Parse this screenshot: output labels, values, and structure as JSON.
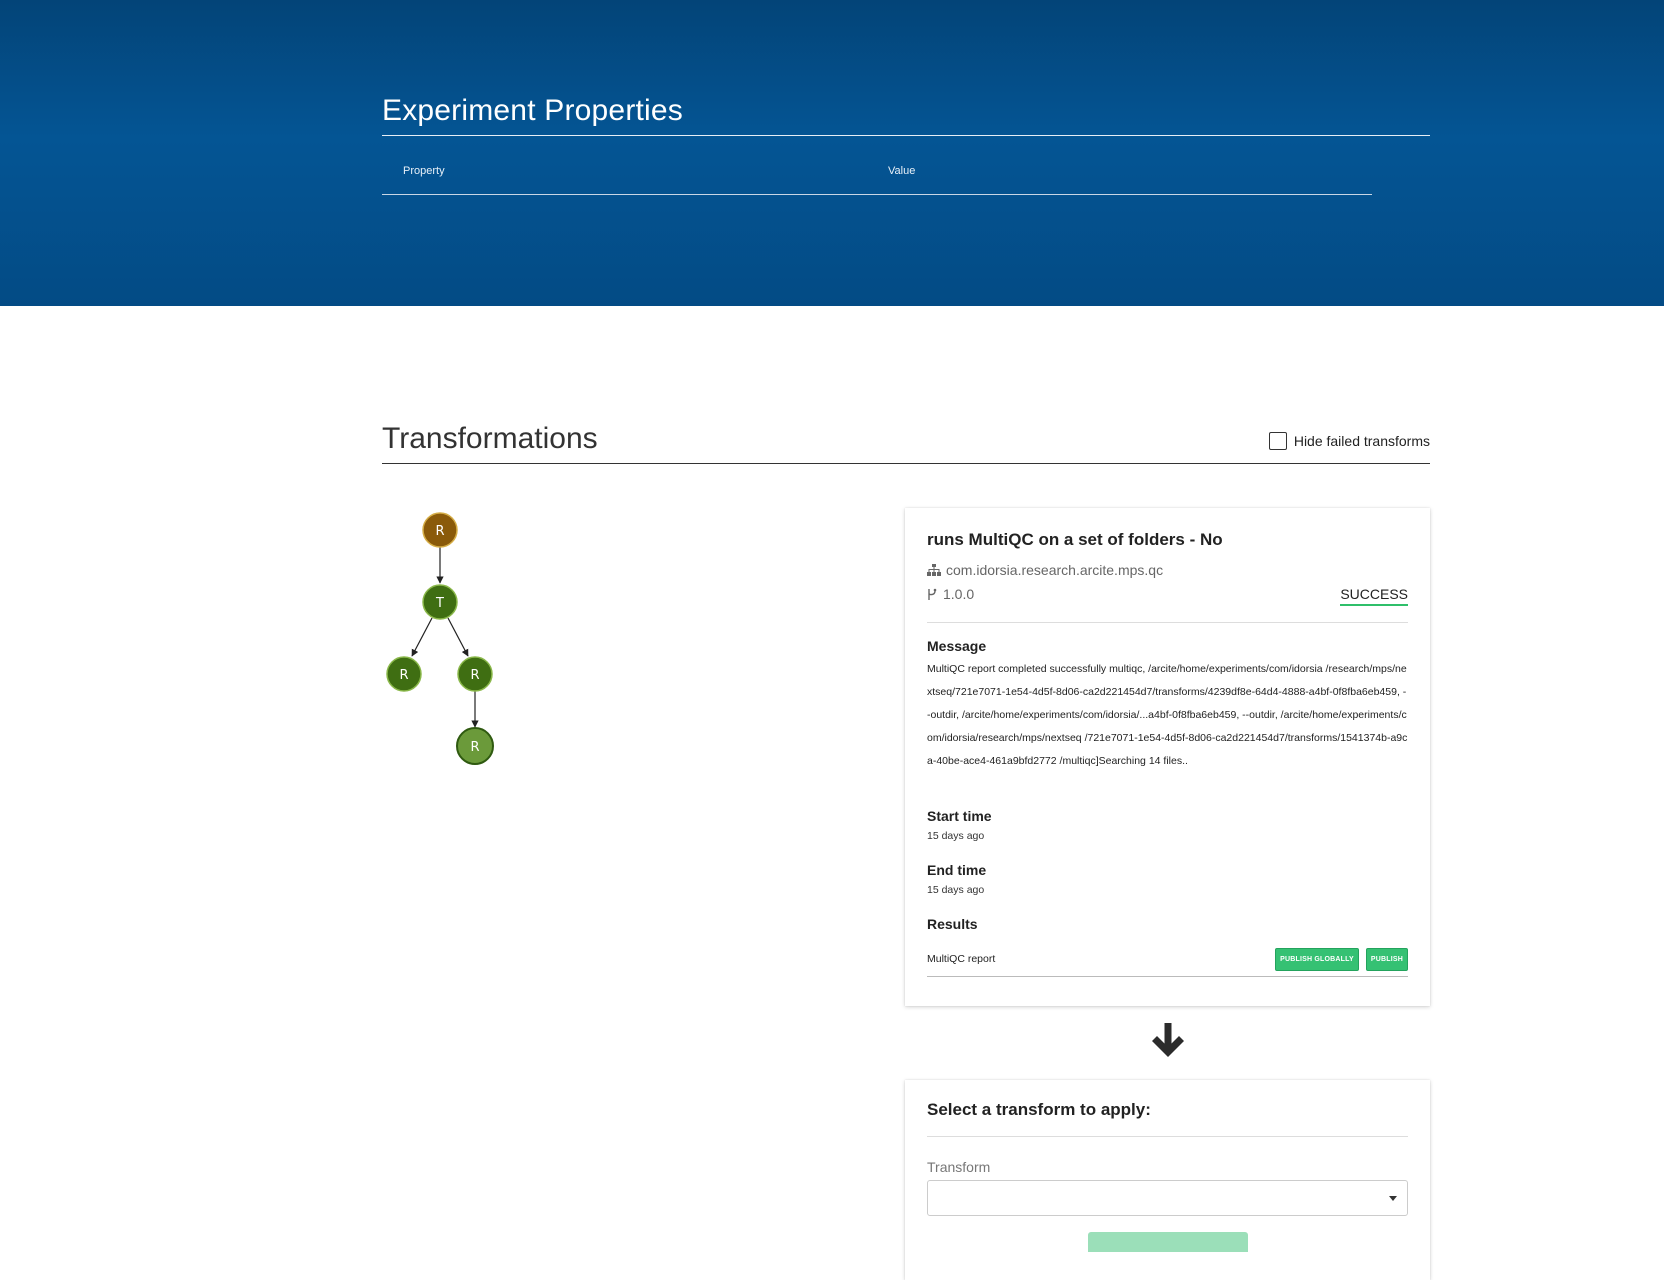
{
  "experiment": {
    "title": "Experiment Properties",
    "table_headers": [
      "Property",
      "Value"
    ]
  },
  "transformations": {
    "title": "Transformations",
    "hide_failed_label": "Hide failed transforms",
    "hide_failed_checked": false
  },
  "graph": {
    "nodes": [
      {
        "label": "R",
        "color": "#8a5a0a"
      },
      {
        "label": "T",
        "color": "#3f6e12"
      },
      {
        "label": "R",
        "color": "#3f6e12"
      },
      {
        "label": "R",
        "color": "#3f6e12"
      },
      {
        "label": "R",
        "color": "#6b9a3a"
      }
    ]
  },
  "detail": {
    "title": "runs MultiQC on a set of folders - No",
    "package": "com.idorsia.research.arcite.mps.qc",
    "version": "1.0.0",
    "status": "SUCCESS",
    "status_color": "#2fbf6a",
    "message_label": "Message",
    "message": "MultiQC report completed successfully multiqc, /arcite/home/experiments/com/idorsia /research/mps/nextseq/721e7071-1e54-4d5f-8d06-ca2d221454d7/transforms/4239df8e-64d4-4888-a4bf-0f8fba6eb459, --outdir, /arcite/home/experiments/com/idorsia/...a4bf-0f8fba6eb459, --outdir, /arcite/home/experiments/com/idorsia/research/mps/nextseq /721e7071-1e54-4d5f-8d06-ca2d221454d7/transforms/1541374b-a9ca-40be-ace4-461a9bfd2772 /multiqc]Searching 14 files..",
    "start_label": "Start time",
    "start_value": "15 days ago",
    "end_label": "End time",
    "end_value": "15 days ago",
    "results_label": "Results",
    "result_name": "MultiQC report",
    "publish_globally_label": "PUBLISH GLOBALLY",
    "publish_label": "PUBLISH",
    "button_color": "#35c173"
  },
  "select_transform": {
    "title": "Select a transform to apply:",
    "field_label": "Transform",
    "value": ""
  },
  "icons": {
    "package": "sitemap-icon",
    "version": "code-fork-icon",
    "flow": "arrow-down-icon"
  }
}
